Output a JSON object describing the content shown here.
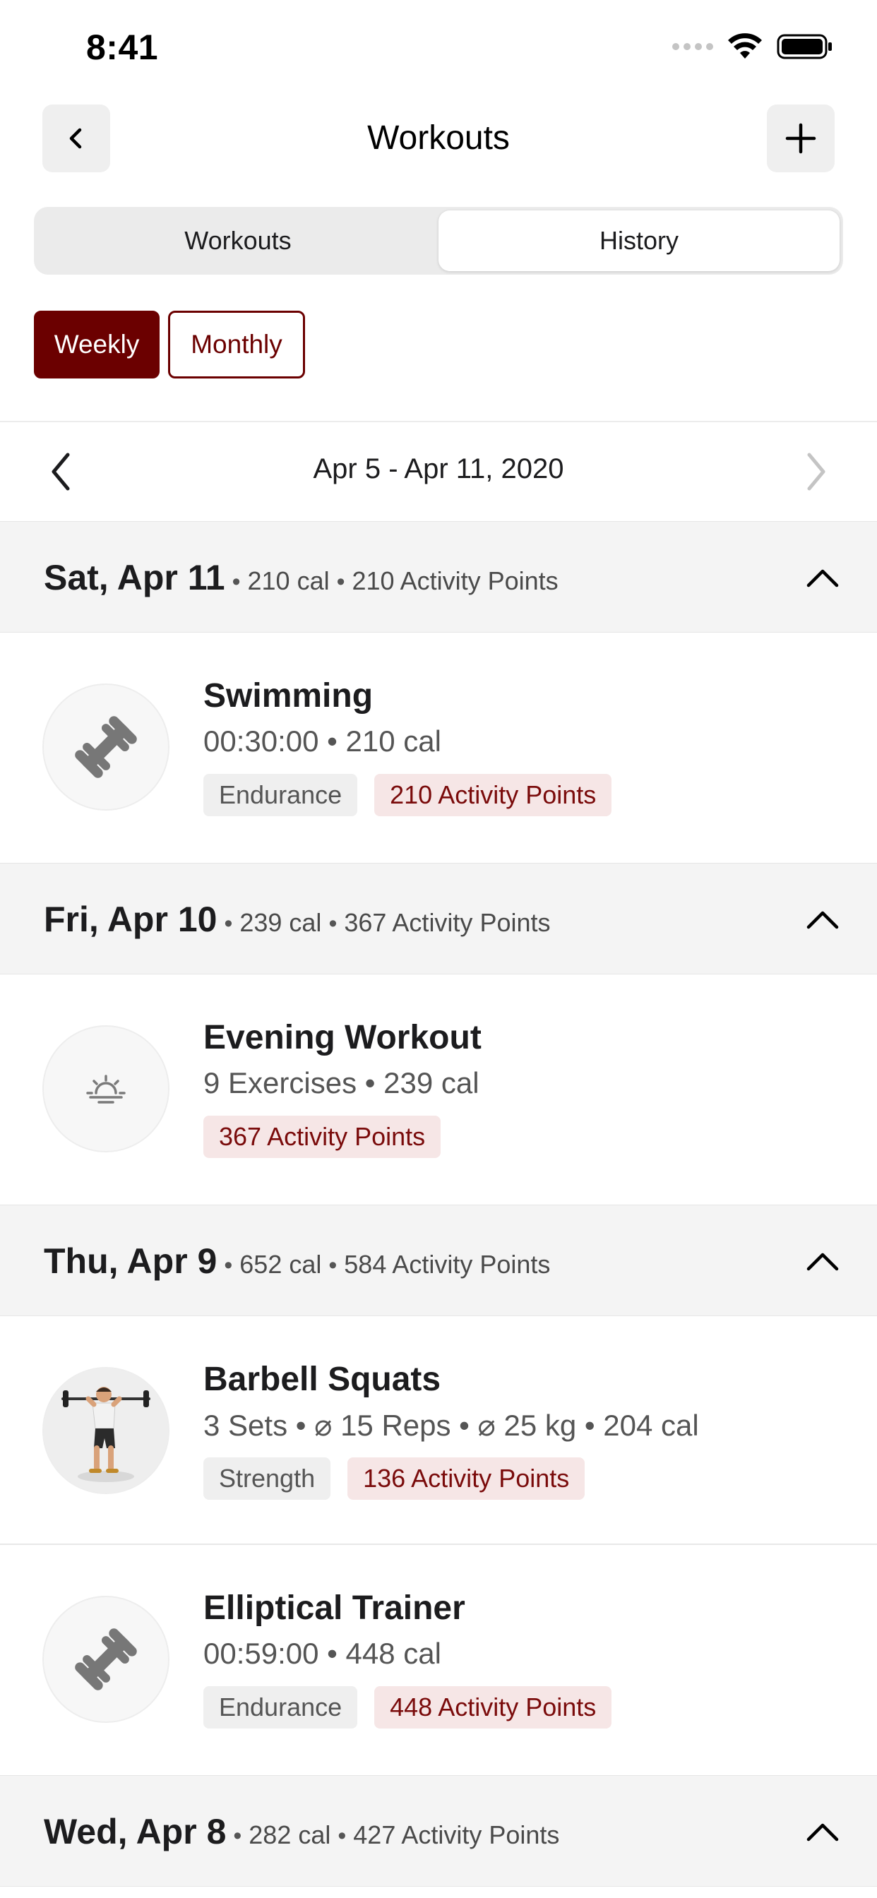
{
  "status_bar": {
    "time": "8:41"
  },
  "header": {
    "title": "Workouts"
  },
  "segments": {
    "workouts": "Workouts",
    "history": "History"
  },
  "period": {
    "weekly": "Weekly",
    "monthly": "Monthly"
  },
  "week": {
    "label": "Apr 5 - Apr 11, 2020"
  },
  "days": [
    {
      "date": "Sat, Apr 11",
      "cal": "210 cal",
      "points": "210 Activity Points",
      "workouts": [
        {
          "icon": "dumbbell-icon",
          "name": "Swimming",
          "meta": "00:30:00 • 210 cal",
          "tag_type": "Endurance",
          "tag_points": "210 Activity Points"
        }
      ]
    },
    {
      "date": "Fri, Apr 10",
      "cal": "239 cal",
      "points": "367 Activity Points",
      "workouts": [
        {
          "icon": "sunset-icon",
          "name": "Evening Workout",
          "meta": "9 Exercises • 239 cal",
          "tag_points": "367 Activity Points"
        }
      ]
    },
    {
      "date": "Thu, Apr 9",
      "cal": "652 cal",
      "points": "584 Activity Points",
      "workouts": [
        {
          "icon": "barbell-squat-figure",
          "name": "Barbell Squats",
          "meta": "3 Sets • ⌀ 15 Reps • ⌀ 25 kg • 204 cal",
          "tag_type": "Strength",
          "tag_points": "136 Activity Points"
        },
        {
          "icon": "dumbbell-icon",
          "name": "Elliptical Trainer",
          "meta": "00:59:00 • 448 cal",
          "tag_type": "Endurance",
          "tag_points": "448 Activity Points"
        }
      ]
    },
    {
      "date": "Wed, Apr 8",
      "cal": "282 cal",
      "points": "427 Activity Points",
      "workouts": []
    }
  ],
  "colors": {
    "accent": "#6b0000",
    "tag_red_bg": "#f6e6e6",
    "tag_grey_bg": "#efefef",
    "section_bg": "#f4f4f4"
  }
}
